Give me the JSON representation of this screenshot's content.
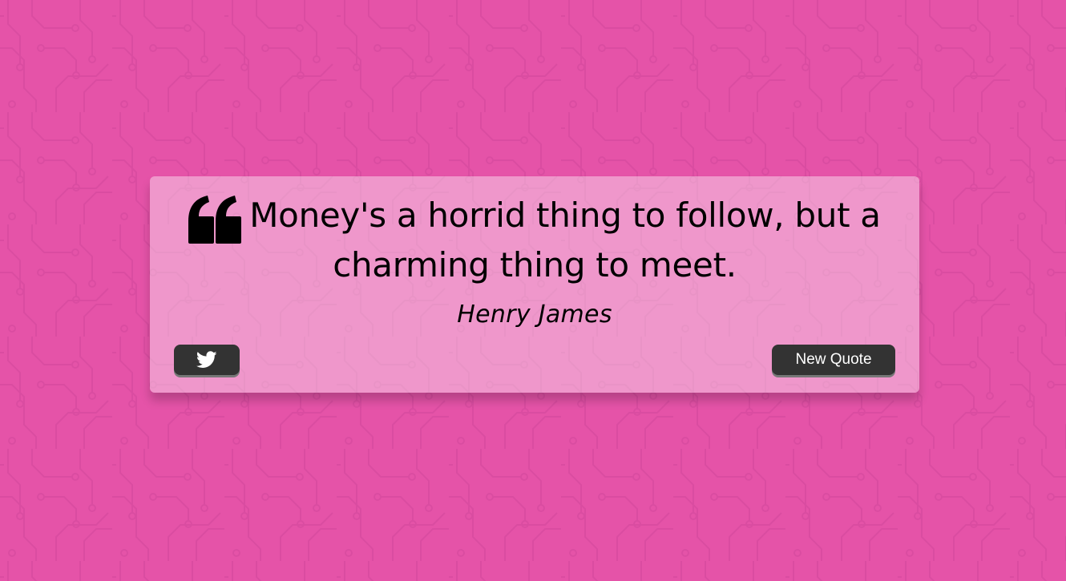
{
  "page": {
    "background_color": "#e553a8",
    "card_background": "rgba(255,255,255,0.4)"
  },
  "quote": {
    "icon": "quote-left-icon",
    "text": "Money's a horrid thing to follow, but a charming thing to meet.",
    "author": "Henry James"
  },
  "buttons": {
    "tweet_icon": "twitter-icon",
    "new_quote_label": "New Quote",
    "button_color": "#333333"
  }
}
